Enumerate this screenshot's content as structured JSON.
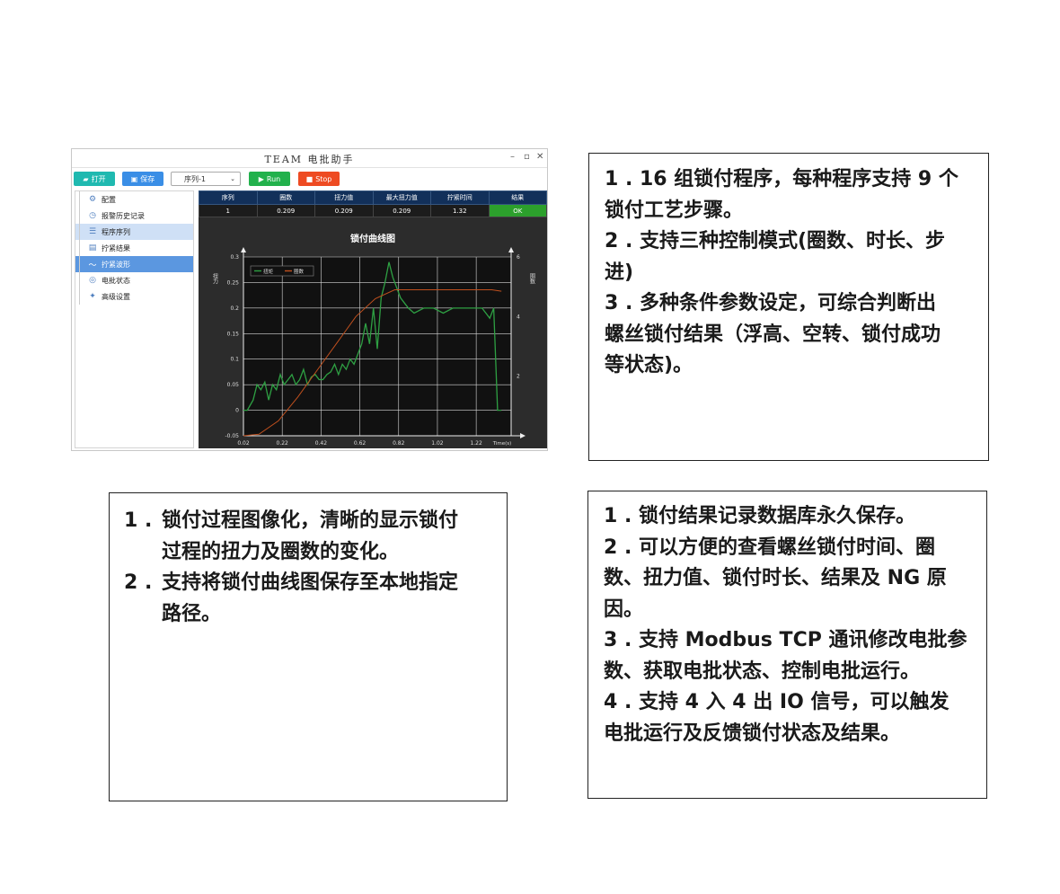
{
  "window": {
    "title": "TEAM 电批助手",
    "controls": [
      "–",
      "▫",
      "✕"
    ]
  },
  "toolbar": {
    "open_label": "打开",
    "save_label": "保存",
    "sequence_selected": "序列-1",
    "run_label": "Run",
    "stop_label": "Stop",
    "colors": {
      "open": "#1fb9b0",
      "save": "#3a8ee6",
      "run": "#22b14c",
      "stop": "#ee4b22"
    }
  },
  "sidebar": {
    "items": [
      {
        "label": "配置",
        "icon": "gear-icon"
      },
      {
        "label": "报警历史记录",
        "icon": "history-icon"
      },
      {
        "label": "程序序列",
        "icon": "list-icon"
      },
      {
        "label": "拧紧结果",
        "icon": "document-icon"
      },
      {
        "label": "拧紧波形",
        "icon": "wave-icon"
      },
      {
        "label": "电批状态",
        "icon": "status-icon"
      },
      {
        "label": "高级设置",
        "icon": "settings-icon"
      }
    ],
    "selected_index": 2,
    "active_index": 4
  },
  "results_table": {
    "headers": [
      "序列",
      "圈数",
      "扭力值",
      "最大扭力值",
      "拧紧时间",
      "结果"
    ],
    "rows": [
      [
        "1",
        "0.209",
        "0.209",
        "0.209",
        "1.32",
        "OK"
      ]
    ]
  },
  "chart_data": {
    "type": "line",
    "title": "锁付曲线图",
    "ylabel": "扭力",
    "y2label": "圈数",
    "xlabel": "Time(s)",
    "xlim": [
      0.02,
      1.4
    ],
    "ylim": [
      -0.05,
      0.3
    ],
    "y2lim": [
      0,
      6
    ],
    "xticks": [
      "0.02",
      "0.22",
      "0.42",
      "0.62",
      "0.82",
      "1.02",
      "1.22"
    ],
    "yticks": [
      "-0.05",
      "0",
      "0.05",
      "0.1",
      "0.15",
      "0.2",
      "0.25",
      "0.3"
    ],
    "y2ticks": [
      "2",
      "4",
      "6"
    ],
    "grid": true,
    "legend_position": "top-left",
    "series": [
      {
        "name": "扭矩",
        "color": "#2ea043",
        "axis": "left",
        "x": [
          0.02,
          0.04,
          0.07,
          0.09,
          0.11,
          0.13,
          0.15,
          0.17,
          0.19,
          0.21,
          0.23,
          0.25,
          0.27,
          0.29,
          0.31,
          0.33,
          0.35,
          0.37,
          0.39,
          0.41,
          0.43,
          0.45,
          0.47,
          0.49,
          0.51,
          0.53,
          0.55,
          0.57,
          0.59,
          0.61,
          0.63,
          0.65,
          0.67,
          0.69,
          0.71,
          0.73,
          0.75,
          0.77,
          0.79,
          0.81,
          0.83,
          0.85,
          0.87,
          0.9,
          0.95,
          1.0,
          1.05,
          1.1,
          1.15,
          1.2,
          1.25,
          1.29,
          1.31,
          1.33,
          1.35
        ],
        "y": [
          0.0,
          0.0,
          0.02,
          0.05,
          0.04,
          0.055,
          0.02,
          0.05,
          0.04,
          0.07,
          0.05,
          0.06,
          0.07,
          0.05,
          0.06,
          0.08,
          0.05,
          0.065,
          0.07,
          0.06,
          0.06,
          0.07,
          0.075,
          0.09,
          0.07,
          0.09,
          0.08,
          0.1,
          0.09,
          0.11,
          0.13,
          0.17,
          0.13,
          0.2,
          0.12,
          0.22,
          0.25,
          0.29,
          0.26,
          0.24,
          0.22,
          0.21,
          0.2,
          0.19,
          0.2,
          0.2,
          0.19,
          0.2,
          0.2,
          0.2,
          0.2,
          0.18,
          0.2,
          0.0,
          0.0
        ]
      },
      {
        "name": "圈数",
        "color": "#c0501e",
        "axis": "right",
        "x": [
          0.02,
          0.1,
          0.2,
          0.3,
          0.4,
          0.5,
          0.6,
          0.7,
          0.8,
          0.9,
          1.0,
          1.1,
          1.2,
          1.3,
          1.35
        ],
        "y": [
          0.0,
          0.05,
          0.5,
          1.3,
          2.2,
          3.1,
          4.0,
          4.6,
          4.9,
          4.9,
          4.9,
          4.9,
          4.9,
          4.9,
          4.85
        ]
      }
    ]
  },
  "box1": {
    "items": [
      [
        "1 . 16 组锁付程序，每种程序支持 9 个",
        "锁付工艺步骤。"
      ],
      [
        "2 . 支持三种控制模式(圈数、时长、步",
        "进)"
      ],
      [
        "3 . 多种条件参数设定，可综合判断出",
        "螺丝锁付结果（浮高、空转、锁付成功",
        "等状态)。"
      ]
    ]
  },
  "box2": {
    "items": [
      {
        "num": "1 .",
        "lines": [
          "锁付过程图像化，清晰的显示锁付",
          "过程的扭力及圈数的变化。"
        ]
      },
      {
        "num": "2 .",
        "lines": [
          "支持将锁付曲线图保存至本地指定",
          "路径。"
        ]
      }
    ]
  },
  "box3": {
    "items": [
      [
        "1 . 锁付结果记录数据库永久保存。"
      ],
      [
        "2 . 可以方便的查看螺丝锁付时间、圈",
        "数、扭力值、锁付时长、结果及 NG 原",
        "因。"
      ],
      [
        "3 . 支持 Modbus TCP 通讯修改电批参",
        "数、获取电批状态、控制电批运行。"
      ],
      [
        "4 . 支持 4 入 4 出 IO 信号，可以触发",
        "电批运行及反馈锁付状态及结果。"
      ]
    ]
  }
}
